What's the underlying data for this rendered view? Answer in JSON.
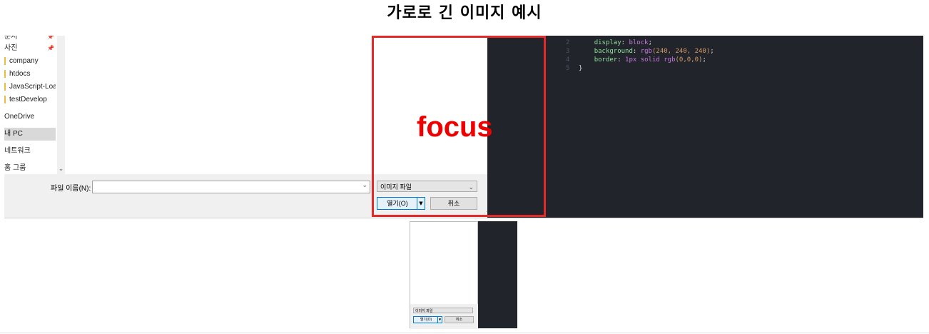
{
  "title": "가로로 긴 이미지 예시",
  "nav": {
    "items": [
      {
        "label": "문서",
        "pinned": true
      },
      {
        "label": "사진",
        "pinned": true
      },
      {
        "label": "company"
      },
      {
        "label": "htdocs"
      },
      {
        "label": "JavaScript-Load-"
      },
      {
        "label": "testDevelop"
      },
      {
        "label": "OneDrive"
      },
      {
        "label": "내 PC",
        "selected": true
      },
      {
        "label": "네트워크"
      },
      {
        "label": "홈 그룹"
      }
    ]
  },
  "dialog": {
    "filename_label": "파일 이름(N):",
    "filename_value": "",
    "filetype": "이미지 파일",
    "open_label": "열기(O)",
    "cancel_label": "취소"
  },
  "editor": {
    "lines": [
      {
        "n": "2",
        "prop": "display",
        "value": "block",
        "tail": ";"
      },
      {
        "n": "3",
        "prop": "background",
        "value": "rgb",
        "args": "(240, 240, 240)",
        "tail": ";"
      },
      {
        "n": "4",
        "prop": "border",
        "value": "1px solid rgb",
        "args": "(0,0,0)",
        "tail": ";"
      },
      {
        "n": "5",
        "brace": "}"
      }
    ]
  },
  "annotation": {
    "label": "focus",
    "color": "#e22a2a"
  },
  "thumbnail": {
    "filetype": "이미지 파일",
    "open_label": "열기(O)",
    "cancel_label": "취소"
  }
}
